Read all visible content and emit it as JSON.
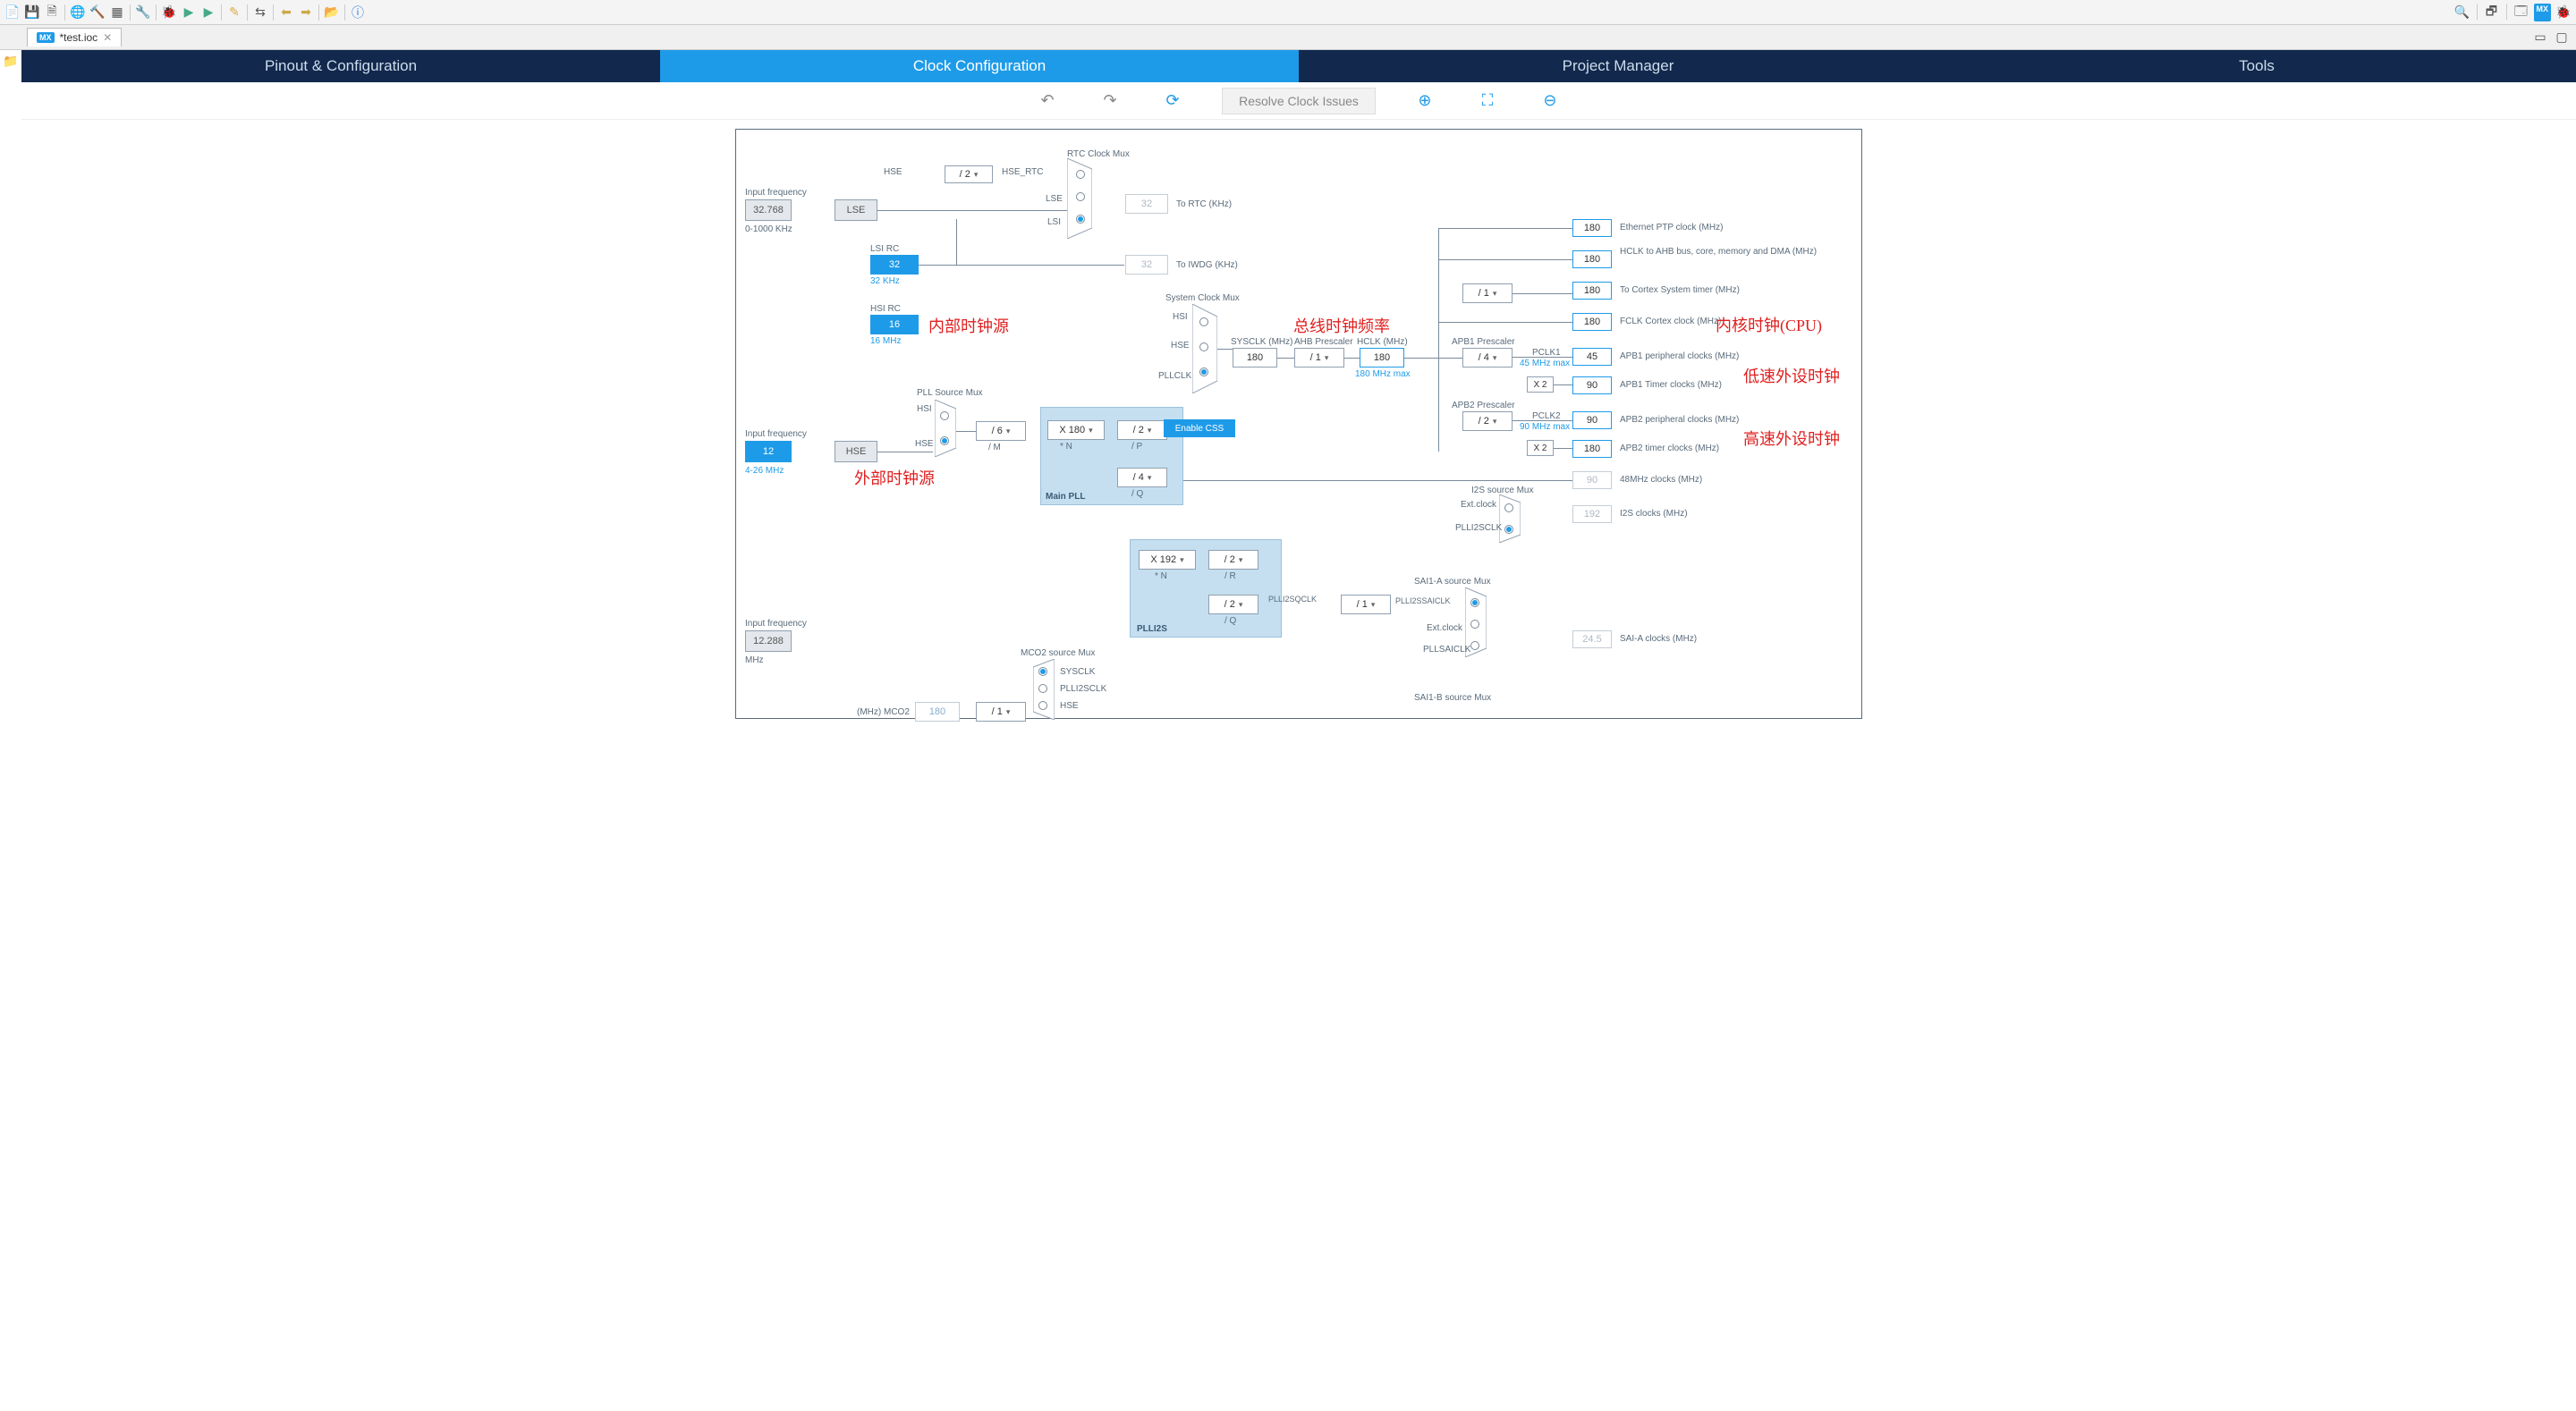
{
  "file_tab": "*test.ioc",
  "main_tabs": {
    "pinout": "Pinout & Configuration",
    "clock": "Clock Configuration",
    "project": "Project Manager",
    "tools": "Tools"
  },
  "action_bar": {
    "resolve": "Resolve Clock Issues"
  },
  "input_freq_label": "Input frequency",
  "lse": {
    "value": "32.768",
    "range": "0-1000 KHz",
    "name": "LSE"
  },
  "lsi": {
    "label": "LSI RC",
    "value": "32",
    "note": "32 KHz"
  },
  "hsi": {
    "label": "HSI RC",
    "value": "16",
    "note": "16 MHz"
  },
  "hse": {
    "value": "12",
    "range": "4-26 MHz",
    "name": "HSE"
  },
  "ext_clk": {
    "value": "12.288",
    "unit": "MHz"
  },
  "rtc_mux_title": "RTC Clock Mux",
  "rtc_div": "/ 2",
  "rtc_labels": {
    "hse": "HSE",
    "hse_rtc": "HSE_RTC",
    "lse": "LSE",
    "lsi": "LSI"
  },
  "to_rtc": {
    "value": "32",
    "label": "To RTC (KHz)"
  },
  "to_iwdg": {
    "value": "32",
    "label": "To IWDG (KHz)"
  },
  "sys_mux_title": "System Clock Mux",
  "sys_labels": {
    "hsi": "HSI",
    "hse": "HSE",
    "pllclk": "PLLCLK"
  },
  "enable_css": "Enable CSS",
  "pll_src_title": "PLL Source Mux",
  "pll_src_labels": {
    "hsi": "HSI",
    "hse": "HSE"
  },
  "pll_m": {
    "value": "/ 6",
    "note": "/ M"
  },
  "main_pll_title": "Main PLL",
  "pll_n": {
    "value": "X 180",
    "note": "* N"
  },
  "pll_p": {
    "value": "/ 2",
    "note": "/ P"
  },
  "pll_q": {
    "value": "/ 4",
    "note": "/ Q"
  },
  "plli2s_title": "PLLI2S",
  "plli2s_n": {
    "value": "X 192",
    "note": "* N"
  },
  "plli2s_r": {
    "value": "/ 2",
    "note": "/ R"
  },
  "plli2s_q": {
    "value": "/ 2",
    "note": "/ Q"
  },
  "sysclk": {
    "label": "SYSCLK (MHz)",
    "value": "180"
  },
  "ahb": {
    "label": "AHB Prescaler",
    "value": "/ 1"
  },
  "hclk": {
    "label": "HCLK (MHz)",
    "value": "180",
    "note": "180 MHz max"
  },
  "cortex_div": "/ 1",
  "apb1": {
    "label": "APB1 Prescaler",
    "value": "/ 4",
    "pclk_label": "PCLK1",
    "pclk_note": "45 MHz max",
    "mult": "X 2"
  },
  "apb2": {
    "label": "APB2 Prescaler",
    "value": "/ 2",
    "pclk_label": "PCLK2",
    "pclk_note": "90 MHz max",
    "mult": "X 2"
  },
  "plli2sq_div": "/ 1",
  "plli2sq_labels": {
    "sqclk": "PLLI2SQCLK",
    "saiclk": "PLLI2SSAICLK"
  },
  "outputs": {
    "eth_ptp": {
      "v": "180",
      "l": "Ethernet PTP clock (MHz)"
    },
    "hclk_ahb": {
      "v": "180",
      "l": "HCLK to AHB bus, core, memory and DMA (MHz)"
    },
    "cortex_sys": {
      "v": "180",
      "l": "To Cortex System timer (MHz)"
    },
    "fclk": {
      "v": "180",
      "l": "FCLK Cortex clock (MHz)"
    },
    "apb1_periph": {
      "v": "45",
      "l": "APB1 peripheral clocks (MHz)"
    },
    "apb1_timer": {
      "v": "90",
      "l": "APB1 Timer clocks (MHz)"
    },
    "apb2_periph": {
      "v": "90",
      "l": "APB2 peripheral clocks (MHz)"
    },
    "apb2_timer": {
      "v": "180",
      "l": "APB2 timer clocks (MHz)"
    },
    "clk48": {
      "v": "90",
      "l": "48MHz clocks (MHz)"
    },
    "i2s": {
      "v": "192",
      "l": "I2S clocks (MHz)"
    },
    "sai_a": {
      "v": "24.5",
      "l": "SAI-A clocks (MHz)"
    }
  },
  "i2s_mux": {
    "title": "I2S source Mux",
    "ext": "Ext.clock",
    "pll": "PLLI2SCLK"
  },
  "sai1a_mux": {
    "title": "SAI1-A source Mux",
    "ext": "Ext.clock",
    "pllsai": "PLLSAICLK"
  },
  "sai1b_mux": {
    "title": "SAI1-B source Mux"
  },
  "mco2": {
    "title": "MCO2 source Mux",
    "sysclk": "SYSCLK",
    "plli2sclk": "PLLI2SCLK",
    "hse": "HSE",
    "out_label": "(MHz) MCO2",
    "value": "180",
    "div": "/ 1"
  },
  "annotations": {
    "internal_src": "内部时钟源",
    "external_src": "外部时钟源",
    "bus_freq": "总线时钟频率",
    "core_clk": "内核时钟(CPU)",
    "low_speed": "低速外设时钟",
    "high_speed": "高速外设时钟"
  }
}
